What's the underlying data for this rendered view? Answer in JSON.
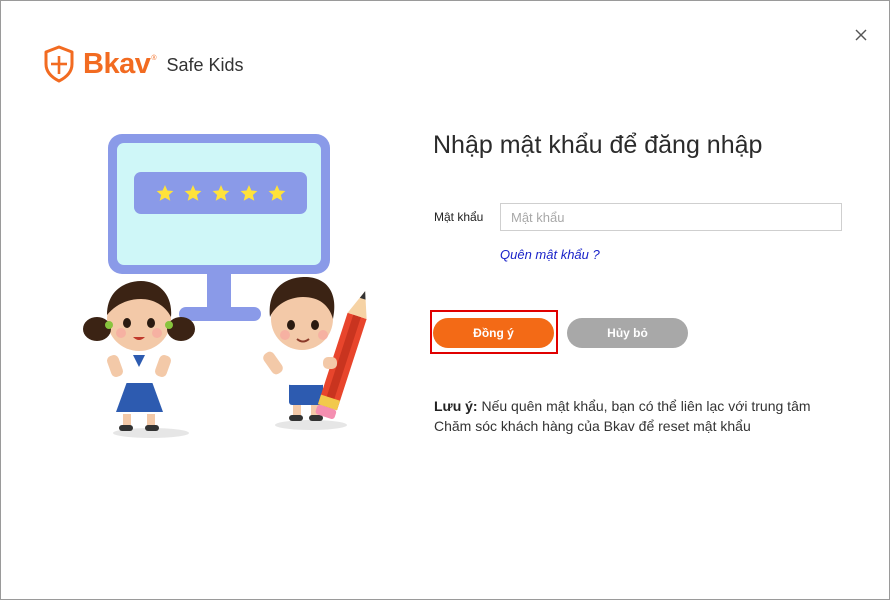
{
  "brand": {
    "name": "Bkav",
    "registered_mark": "®",
    "product": "Safe Kids",
    "color": "#f26b21"
  },
  "window": {
    "close_icon": "close-icon"
  },
  "login": {
    "title": "Nhập mật khẩu để đăng nhập",
    "password_label": "Mật khẩu",
    "password_placeholder": "Mật khẩu",
    "password_value": "",
    "forgot_link": "Quên mật khẩu ?"
  },
  "buttons": {
    "ok_label": "Đồng ý",
    "cancel_label": "Hủy bỏ",
    "ok_color": "#f36a16",
    "cancel_color": "#a8a8a8"
  },
  "note": {
    "label": "Lưu ý:",
    "line1": "Nếu quên mật khẩu, bạn có thể liên lạc với trung tâm",
    "line2": "Chăm sóc khách hàng của Bkav để reset mật khẩu"
  },
  "illustration": {
    "masked_password": "★★★★★",
    "icon": "kids-computer-password-illustration"
  }
}
